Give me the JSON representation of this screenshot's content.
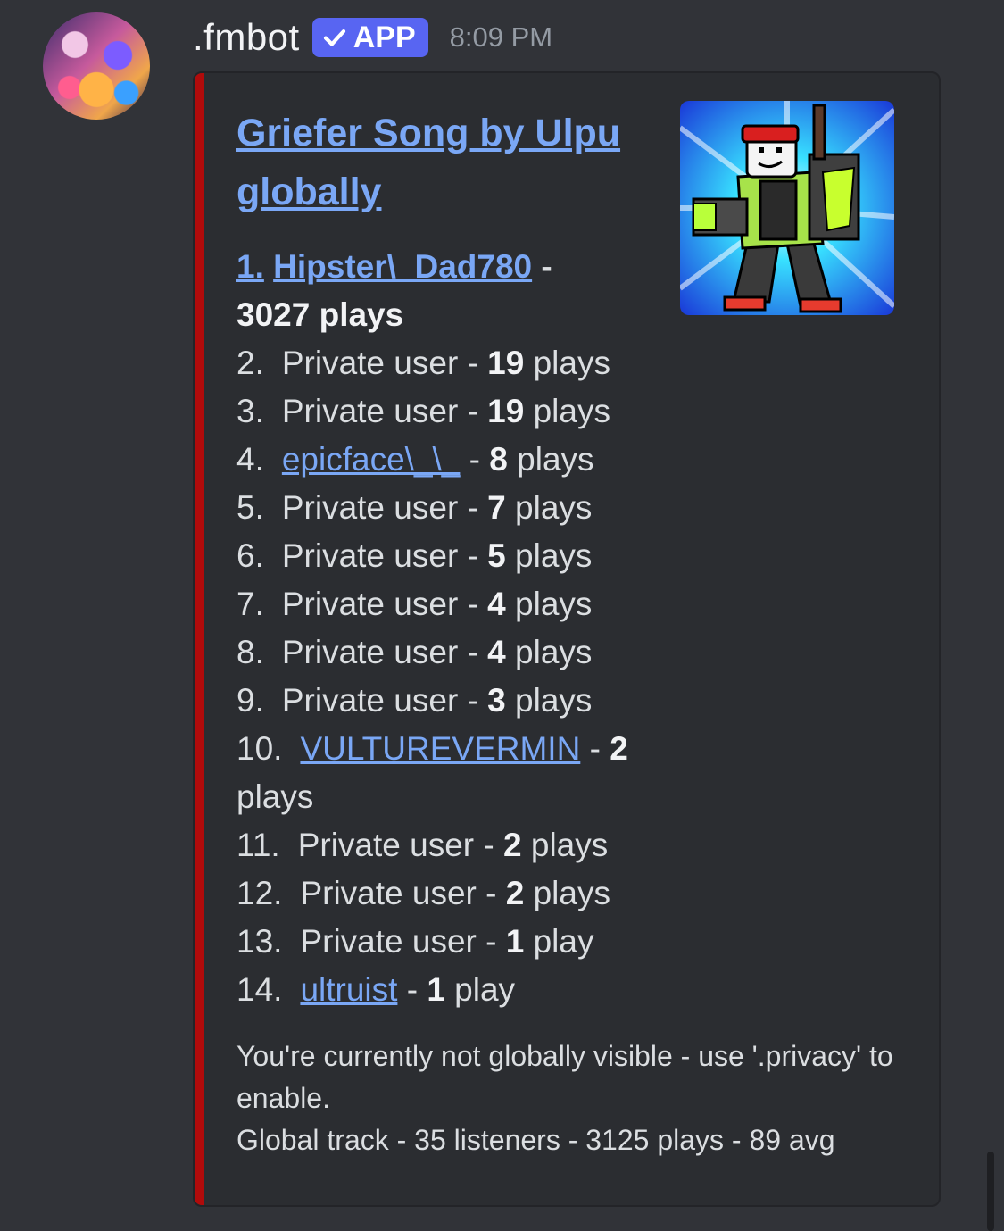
{
  "message": {
    "username": ".fmbot",
    "badge_label": "APP",
    "timestamp": "8:09 PM"
  },
  "embed": {
    "accent_color": "#b00b0b",
    "title": "Griefer Song by Ulpu globally",
    "first_entry": {
      "rank": "1.",
      "user": "Hipster\\_Dad780",
      "separator": " - ",
      "plays": "3027 plays"
    },
    "entries": [
      {
        "rank": "2.",
        "user": "Private user",
        "link": false,
        "count": "19",
        "unit": "plays"
      },
      {
        "rank": "3.",
        "user": "Private user",
        "link": false,
        "count": "19",
        "unit": "plays"
      },
      {
        "rank": "4.",
        "user": "epicface\\_\\_",
        "link": true,
        "count": "8",
        "unit": "plays"
      },
      {
        "rank": "5.",
        "user": "Private user",
        "link": false,
        "count": "7",
        "unit": "plays"
      },
      {
        "rank": "6.",
        "user": "Private user",
        "link": false,
        "count": "5",
        "unit": "plays"
      },
      {
        "rank": "7.",
        "user": "Private user",
        "link": false,
        "count": "4",
        "unit": "plays"
      },
      {
        "rank": "8.",
        "user": "Private user",
        "link": false,
        "count": "4",
        "unit": "plays"
      },
      {
        "rank": "9.",
        "user": "Private user",
        "link": false,
        "count": "3",
        "unit": "plays"
      },
      {
        "rank": "10.",
        "user": "VULTUREVERMIN",
        "link": true,
        "count": "2",
        "unit": "plays"
      },
      {
        "rank": "11.",
        "user": "Private user",
        "link": false,
        "count": "2",
        "unit": "plays"
      },
      {
        "rank": "12.",
        "user": "Private user",
        "link": false,
        "count": "2",
        "unit": "plays"
      },
      {
        "rank": "13.",
        "user": "Private user",
        "link": false,
        "count": "1",
        "unit": "play"
      },
      {
        "rank": "14.",
        "user": "ultruist",
        "link": true,
        "count": "1",
        "unit": "play"
      }
    ],
    "footer_notice": "You're currently not globally visible - use '.privacy' to enable.",
    "footer_stats": "Global track - 35 listeners - 3125 plays - 89 avg"
  },
  "colors": {
    "background": "#313338",
    "embed_background": "#2b2d31",
    "link": "#7aa7f5",
    "badge": "#5865f2"
  }
}
